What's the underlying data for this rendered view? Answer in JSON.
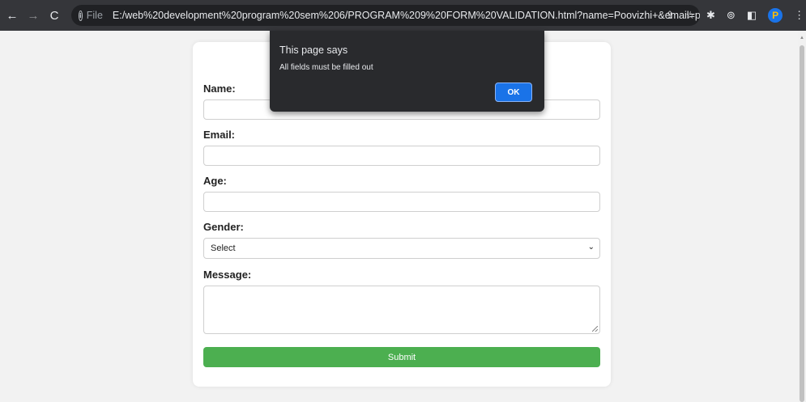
{
  "browser": {
    "scheme": "File",
    "url": "E:/web%20development%20program%20sem%206/PROGRAM%209%20FORM%20VALIDATION.html?name=Poovizhi+&email=poovizhi.ganga...",
    "profile_initial": "P"
  },
  "form": {
    "name_label": "Name:",
    "email_label": "Email:",
    "age_label": "Age:",
    "gender_label": "Gender:",
    "gender_selected": "Select",
    "message_label": "Message:",
    "submit_label": "Submit"
  },
  "alert": {
    "title": "This page says",
    "message": "All fields must be filled out",
    "ok_label": "OK"
  },
  "colors": {
    "submit": "#4caf50",
    "alert_bg": "#292a2d",
    "ok_button": "#1a73e8",
    "toolbar": "#35363a"
  }
}
